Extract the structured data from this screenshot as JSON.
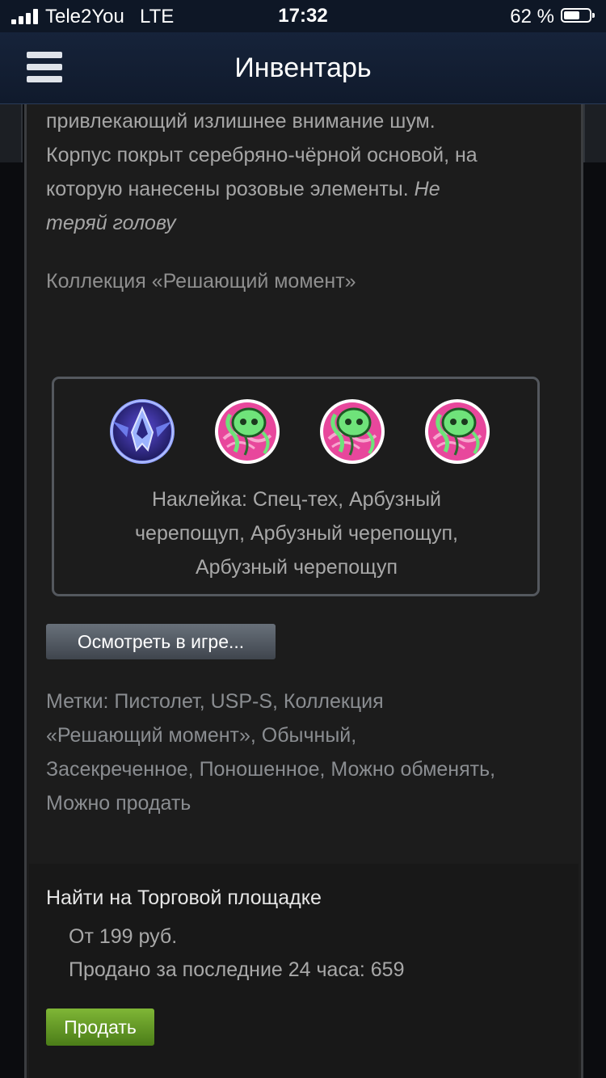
{
  "status_bar": {
    "carrier": "Tele2You",
    "network": "LTE",
    "time": "17:32",
    "battery_percent": "62 %",
    "battery_level": 0.62
  },
  "nav": {
    "title": "Инвентарь",
    "menu_icon": "hamburger-menu-icon"
  },
  "item": {
    "description_line1": "привлекающий излишнее внимание шум.",
    "description_line2": "Корпус покрыт серебряно-чёрной основой, на",
    "description_line3": "которую нанесены розовые элементы.",
    "description_italic_a": "Не",
    "description_italic_b": "теряй голову",
    "collection": "Коллекция «Решающий момент»"
  },
  "stickers": {
    "icons": [
      "spec-tech-sticker-icon",
      "watermelon-skull-sticker-icon",
      "watermelon-skull-sticker-icon",
      "watermelon-skull-sticker-icon"
    ],
    "line1": "Наклейка: Спец-тех, Арбузный",
    "line2": "черепощуп, Арбузный черепощуп,",
    "line3": "Арбузный черепощуп"
  },
  "actions": {
    "inspect_label": "Осмотреть в игре..."
  },
  "tags": {
    "line1": "Метки: Пистолет, USP-S, Коллекция",
    "line2": "«Решающий момент», Обычный,",
    "line3": "Засекреченное, Поношенное, Можно обменять,",
    "line4": "Можно продать"
  },
  "market": {
    "heading": "Найти на Торговой площадке",
    "price": "От 199 руб.",
    "sold_24h": "Продано за последние 24 часа: 659",
    "sell_label": "Продать"
  },
  "colors": {
    "panel_bg": "#1c1c1c",
    "nav_bg": "#16233a",
    "sell_green": "#7fb636",
    "sticker_pink": "#e8479c",
    "sticker_green": "#6fe37a"
  }
}
